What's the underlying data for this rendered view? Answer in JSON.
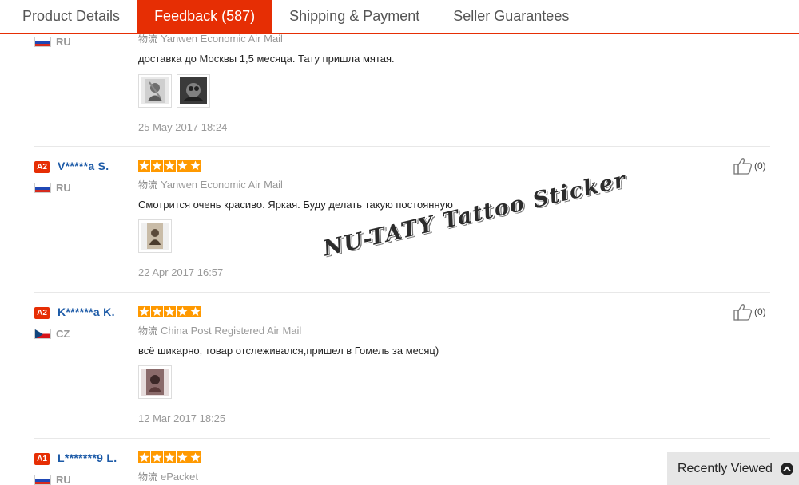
{
  "tabs": [
    {
      "label": "Product Details",
      "active": false
    },
    {
      "label": "Feedback (587)",
      "active": true
    },
    {
      "label": "Shipping & Payment",
      "active": false
    },
    {
      "label": "Seller Guarantees",
      "active": false
    }
  ],
  "shipping_prefix": "物流",
  "reviews": [
    {
      "country": "RU",
      "shipping": "Yanwen Economic Air Mail",
      "text": "доставка до Москвы 1,5 месяца. Тату пришла мятая.",
      "date": "25 May 2017 18:24",
      "photos": 2
    },
    {
      "grade": "A2",
      "user": "V*****a S.",
      "country": "RU",
      "rating": 5,
      "shipping": "Yanwen Economic Air Mail",
      "text": "Смотрится очень красиво. Яркая. Буду делать такую постоянную",
      "date": "22 Apr 2017 16:57",
      "helpful": "(0)",
      "photos": 1
    },
    {
      "grade": "A2",
      "user": "K******a K.",
      "country": "CZ",
      "rating": 5,
      "shipping": "China Post Registered Air Mail",
      "text": "всё шикарно, товар отслеживался,пришел в Гомель за месяц)",
      "date": "12 Mar 2017 18:25",
      "helpful": "(0)",
      "photos": 1
    },
    {
      "grade": "A1",
      "user": "L*******9 L.",
      "country": "RU",
      "rating": 5,
      "shipping": "ePacket"
    }
  ],
  "watermark": "NU-TATY Tattoo Sticker",
  "recently_viewed": "Recently Viewed",
  "colors": {
    "accent": "#e62e04",
    "star": "#ff9900",
    "user_link": "#1c5aa7"
  }
}
